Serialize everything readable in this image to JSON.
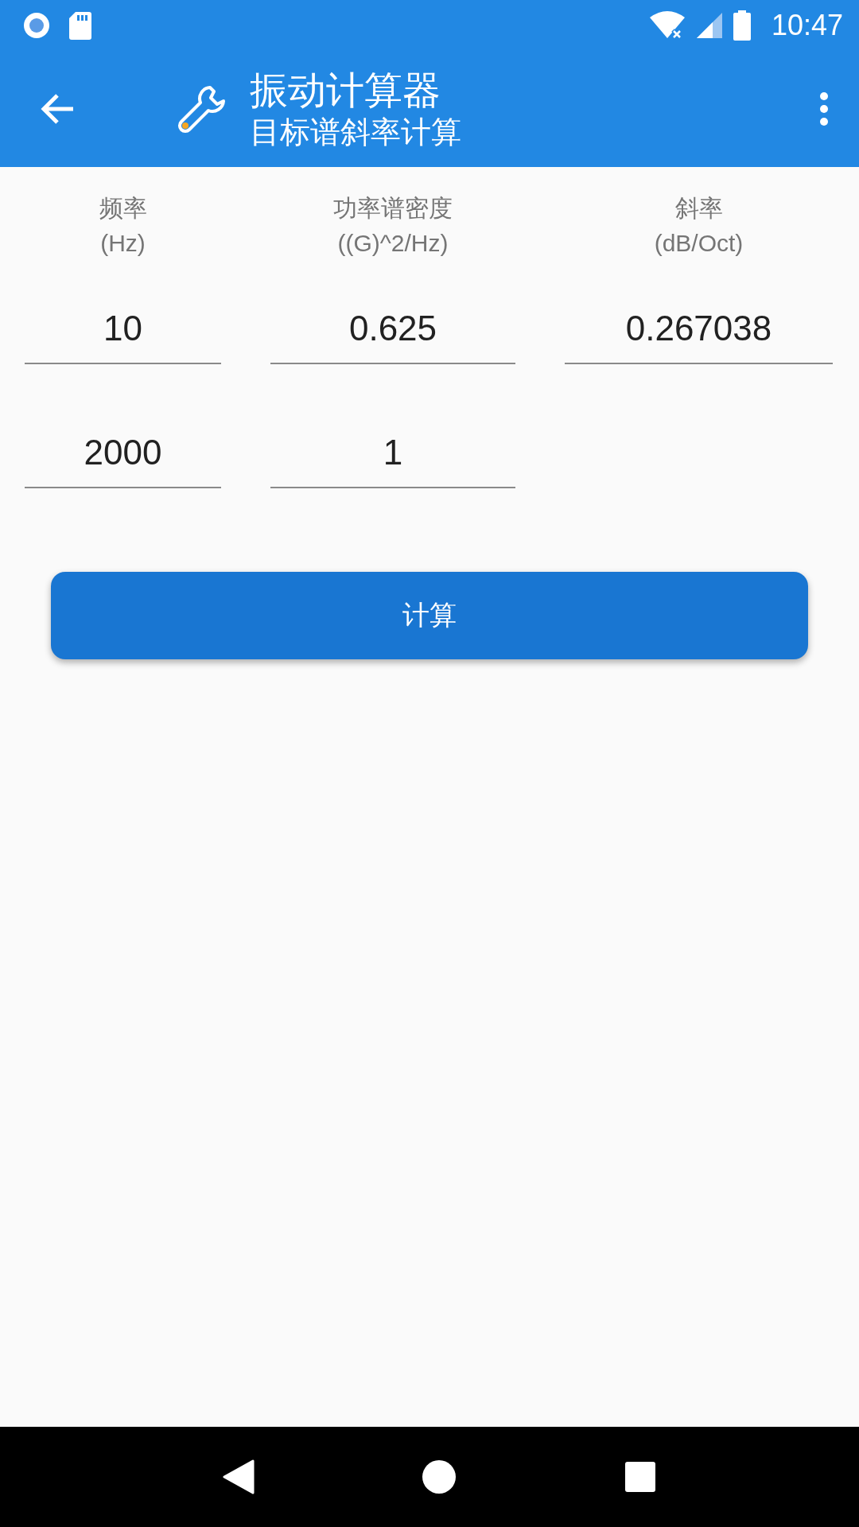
{
  "status_bar": {
    "time": "10:47"
  },
  "app_bar": {
    "title": "振动计算器",
    "subtitle": "目标谱斜率计算"
  },
  "columns": [
    {
      "label": "频率",
      "unit": "(Hz)"
    },
    {
      "label": "功率谱密度",
      "unit": "((G)^2/Hz)"
    },
    {
      "label": "斜率",
      "unit": "(dB/Oct)"
    }
  ],
  "rows": [
    [
      "10",
      "0.625",
      "0.267038"
    ],
    [
      "2000",
      "1"
    ]
  ],
  "button": "计算"
}
